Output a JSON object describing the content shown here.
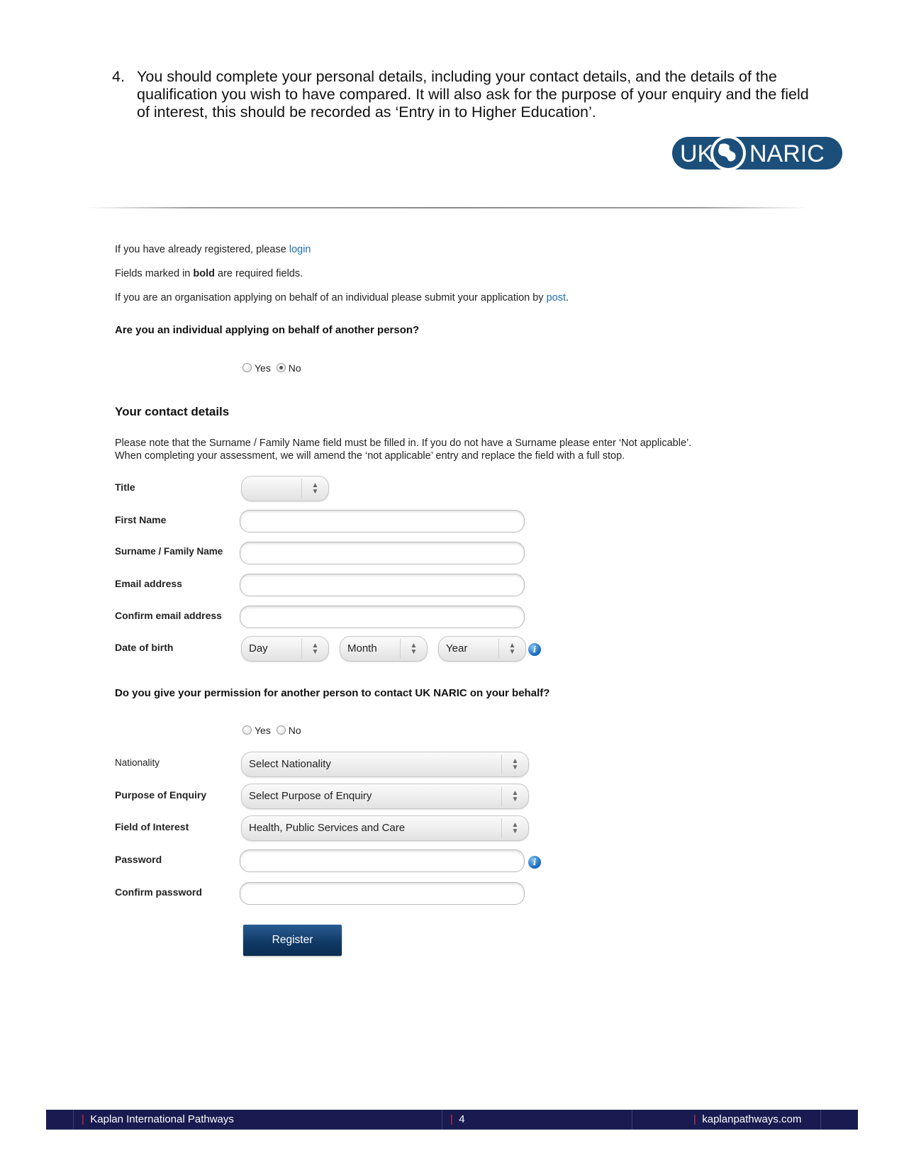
{
  "instruction": {
    "number": "4.",
    "text": "You should complete your personal details, including your contact details, and the details of the qualification you wish to have compared. It will also ask for the purpose of your enquiry and the field of interest, this should be recorded as ‘Entry in to Higher Education’."
  },
  "logo": {
    "left": "UK",
    "right": "NARIC",
    "color": "#1b4f7a"
  },
  "form": {
    "registered_prefix": "If you have already registered, please ",
    "login_link": "login",
    "bold_note_prefix": "Fields marked in ",
    "bold_word": "bold",
    "bold_note_suffix": " are required fields.",
    "org_prefix": "If you are an organisation applying on behalf of an individual please submit your application by ",
    "post_link": "post",
    "org_suffix": ".",
    "behalf_question": "Are you an individual applying on behalf of another person?",
    "behalf_options": {
      "yes": "Yes",
      "no": "No",
      "selected": "No"
    },
    "contact_heading": "Your contact details",
    "surname_note_1": "Please note that the Surname / Family Name field must be filled in. If you do not have a Surname please enter ‘Not applicable’.",
    "surname_note_2": "When completing your assessment, we will amend the ‘not applicable’ entry and replace the field with a full stop.",
    "labels": {
      "title": "Title",
      "first_name": "First Name",
      "surname": "Surname / Family Name",
      "email": "Email address",
      "confirm_email": "Confirm email address",
      "dob": "Date of birth",
      "nationality": "Nationality",
      "purpose": "Purpose of Enquiry",
      "field": "Field of Interest",
      "password": "Password",
      "confirm_password": "Confirm password"
    },
    "dob_selects": {
      "day": "Day",
      "month": "Month",
      "year": "Year"
    },
    "permission_question": "Do you give your permission for another person to contact UK NARIC on your behalf?",
    "permission_options": {
      "yes": "Yes",
      "no": "No",
      "selected": ""
    },
    "nationality_value": "Select Nationality",
    "purpose_value": "Select Purpose of Enquiry",
    "field_value": "Health, Public Services and Care",
    "register_button": "Register"
  },
  "footer": {
    "left": "Kaplan International Pathways",
    "page": "4",
    "right": "kaplanpathways.com",
    "background": "#191b50",
    "separator_color": "#d32f3a"
  }
}
